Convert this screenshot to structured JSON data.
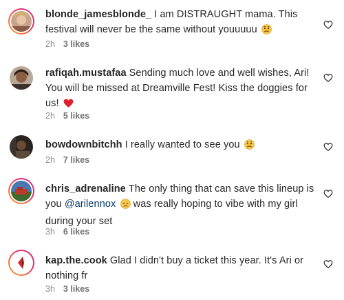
{
  "comments": [
    {
      "username": "blonde_jamesblonde_",
      "text": "I am DISTRAUGHT mama. This festival will never be the same without youuuuu",
      "emoji": "worried-face",
      "time": "2h",
      "likes": "3 likes"
    },
    {
      "username": "rafiqah.mustafaa",
      "text": "Sending much love and well wishes, Ari! You will be missed at Dreamville Fest! Kiss the doggies for us!",
      "emoji": "red-heart",
      "time": "2h",
      "likes": "5 likes"
    },
    {
      "username": "bowdownbitchh",
      "text": "I really wanted to see you",
      "emoji": "worried-face",
      "time": "2h",
      "likes": "7 likes"
    },
    {
      "username": "chris_adrenaline",
      "text_before": "The only thing that can save this lineup is you",
      "mention": "@arilennox",
      "text_after": "was really hoping to vibe with my girl during your set",
      "emoji": "disappointed-face",
      "time": "3h",
      "likes": "6 likes"
    },
    {
      "username": "kap.the.cook",
      "text": "Glad I didn't buy a ticket this year. It's Ari or nothing fr",
      "time": "3h",
      "likes": "3 likes"
    }
  ],
  "icons": {
    "like": "heart-outline-icon",
    "accent": "#e1306c",
    "mention_color": "#00376b"
  }
}
